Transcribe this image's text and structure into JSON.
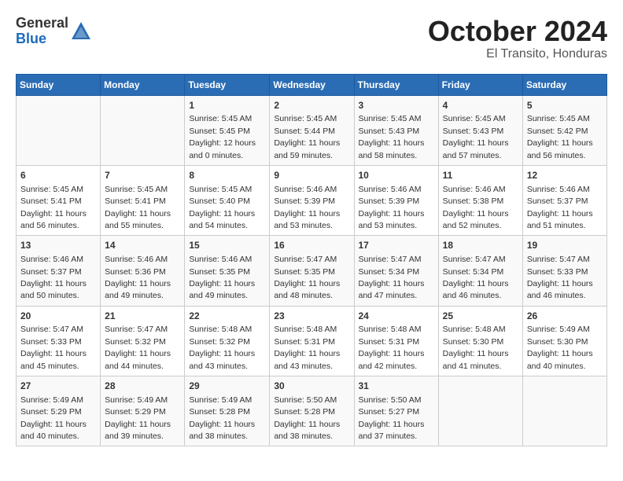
{
  "header": {
    "logo_general": "General",
    "logo_blue": "Blue",
    "title": "October 2024",
    "subtitle": "El Transito, Honduras"
  },
  "weekdays": [
    "Sunday",
    "Monday",
    "Tuesday",
    "Wednesday",
    "Thursday",
    "Friday",
    "Saturday"
  ],
  "weeks": [
    [
      {
        "day": "",
        "detail": ""
      },
      {
        "day": "",
        "detail": ""
      },
      {
        "day": "1",
        "detail": "Sunrise: 5:45 AM\nSunset: 5:45 PM\nDaylight: 12 hours\nand 0 minutes."
      },
      {
        "day": "2",
        "detail": "Sunrise: 5:45 AM\nSunset: 5:44 PM\nDaylight: 11 hours\nand 59 minutes."
      },
      {
        "day": "3",
        "detail": "Sunrise: 5:45 AM\nSunset: 5:43 PM\nDaylight: 11 hours\nand 58 minutes."
      },
      {
        "day": "4",
        "detail": "Sunrise: 5:45 AM\nSunset: 5:43 PM\nDaylight: 11 hours\nand 57 minutes."
      },
      {
        "day": "5",
        "detail": "Sunrise: 5:45 AM\nSunset: 5:42 PM\nDaylight: 11 hours\nand 56 minutes."
      }
    ],
    [
      {
        "day": "6",
        "detail": "Sunrise: 5:45 AM\nSunset: 5:41 PM\nDaylight: 11 hours\nand 56 minutes."
      },
      {
        "day": "7",
        "detail": "Sunrise: 5:45 AM\nSunset: 5:41 PM\nDaylight: 11 hours\nand 55 minutes."
      },
      {
        "day": "8",
        "detail": "Sunrise: 5:45 AM\nSunset: 5:40 PM\nDaylight: 11 hours\nand 54 minutes."
      },
      {
        "day": "9",
        "detail": "Sunrise: 5:46 AM\nSunset: 5:39 PM\nDaylight: 11 hours\nand 53 minutes."
      },
      {
        "day": "10",
        "detail": "Sunrise: 5:46 AM\nSunset: 5:39 PM\nDaylight: 11 hours\nand 53 minutes."
      },
      {
        "day": "11",
        "detail": "Sunrise: 5:46 AM\nSunset: 5:38 PM\nDaylight: 11 hours\nand 52 minutes."
      },
      {
        "day": "12",
        "detail": "Sunrise: 5:46 AM\nSunset: 5:37 PM\nDaylight: 11 hours\nand 51 minutes."
      }
    ],
    [
      {
        "day": "13",
        "detail": "Sunrise: 5:46 AM\nSunset: 5:37 PM\nDaylight: 11 hours\nand 50 minutes."
      },
      {
        "day": "14",
        "detail": "Sunrise: 5:46 AM\nSunset: 5:36 PM\nDaylight: 11 hours\nand 49 minutes."
      },
      {
        "day": "15",
        "detail": "Sunrise: 5:46 AM\nSunset: 5:35 PM\nDaylight: 11 hours\nand 49 minutes."
      },
      {
        "day": "16",
        "detail": "Sunrise: 5:47 AM\nSunset: 5:35 PM\nDaylight: 11 hours\nand 48 minutes."
      },
      {
        "day": "17",
        "detail": "Sunrise: 5:47 AM\nSunset: 5:34 PM\nDaylight: 11 hours\nand 47 minutes."
      },
      {
        "day": "18",
        "detail": "Sunrise: 5:47 AM\nSunset: 5:34 PM\nDaylight: 11 hours\nand 46 minutes."
      },
      {
        "day": "19",
        "detail": "Sunrise: 5:47 AM\nSunset: 5:33 PM\nDaylight: 11 hours\nand 46 minutes."
      }
    ],
    [
      {
        "day": "20",
        "detail": "Sunrise: 5:47 AM\nSunset: 5:33 PM\nDaylight: 11 hours\nand 45 minutes."
      },
      {
        "day": "21",
        "detail": "Sunrise: 5:47 AM\nSunset: 5:32 PM\nDaylight: 11 hours\nand 44 minutes."
      },
      {
        "day": "22",
        "detail": "Sunrise: 5:48 AM\nSunset: 5:32 PM\nDaylight: 11 hours\nand 43 minutes."
      },
      {
        "day": "23",
        "detail": "Sunrise: 5:48 AM\nSunset: 5:31 PM\nDaylight: 11 hours\nand 43 minutes."
      },
      {
        "day": "24",
        "detail": "Sunrise: 5:48 AM\nSunset: 5:31 PM\nDaylight: 11 hours\nand 42 minutes."
      },
      {
        "day": "25",
        "detail": "Sunrise: 5:48 AM\nSunset: 5:30 PM\nDaylight: 11 hours\nand 41 minutes."
      },
      {
        "day": "26",
        "detail": "Sunrise: 5:49 AM\nSunset: 5:30 PM\nDaylight: 11 hours\nand 40 minutes."
      }
    ],
    [
      {
        "day": "27",
        "detail": "Sunrise: 5:49 AM\nSunset: 5:29 PM\nDaylight: 11 hours\nand 40 minutes."
      },
      {
        "day": "28",
        "detail": "Sunrise: 5:49 AM\nSunset: 5:29 PM\nDaylight: 11 hours\nand 39 minutes."
      },
      {
        "day": "29",
        "detail": "Sunrise: 5:49 AM\nSunset: 5:28 PM\nDaylight: 11 hours\nand 38 minutes."
      },
      {
        "day": "30",
        "detail": "Sunrise: 5:50 AM\nSunset: 5:28 PM\nDaylight: 11 hours\nand 38 minutes."
      },
      {
        "day": "31",
        "detail": "Sunrise: 5:50 AM\nSunset: 5:27 PM\nDaylight: 11 hours\nand 37 minutes."
      },
      {
        "day": "",
        "detail": ""
      },
      {
        "day": "",
        "detail": ""
      }
    ]
  ]
}
